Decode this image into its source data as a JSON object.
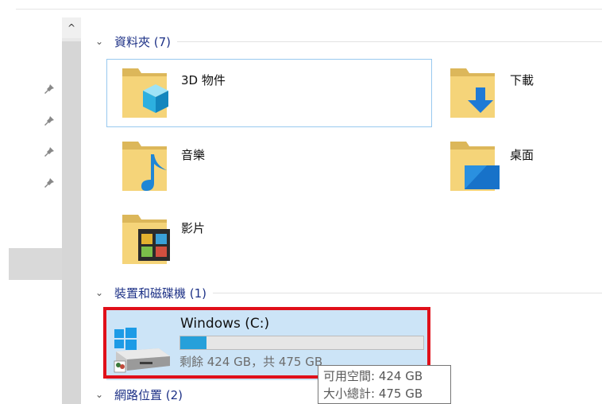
{
  "groups": {
    "folders": {
      "title": "資料夾 (7)"
    },
    "devices": {
      "title": "裝置和磁碟機 (1)"
    },
    "network": {
      "title": "網路位置 (2)"
    }
  },
  "folders": [
    {
      "label": "3D 物件",
      "icon": "3d-objects-folder-icon"
    },
    {
      "label": "下載",
      "icon": "downloads-folder-icon"
    },
    {
      "label": "音樂",
      "icon": "music-folder-icon"
    },
    {
      "label": "桌面",
      "icon": "desktop-folder-icon"
    },
    {
      "label": "影片",
      "icon": "videos-folder-icon"
    }
  ],
  "drive": {
    "name": "Windows (C:)",
    "info": "剩餘 424 GB，共 475 GB",
    "used_fraction": 0.107,
    "icon": "windows-drive-icon"
  },
  "tooltip": {
    "line1": "可用空間: 424 GB",
    "line2": "大小總計: 475 GB"
  },
  "scroll_up_glyph": "^",
  "colors": {
    "accent_blue": "#26a0da",
    "selection": "#cce4f7",
    "highlight_red": "#e0101a",
    "group_header": "#1e3287"
  }
}
